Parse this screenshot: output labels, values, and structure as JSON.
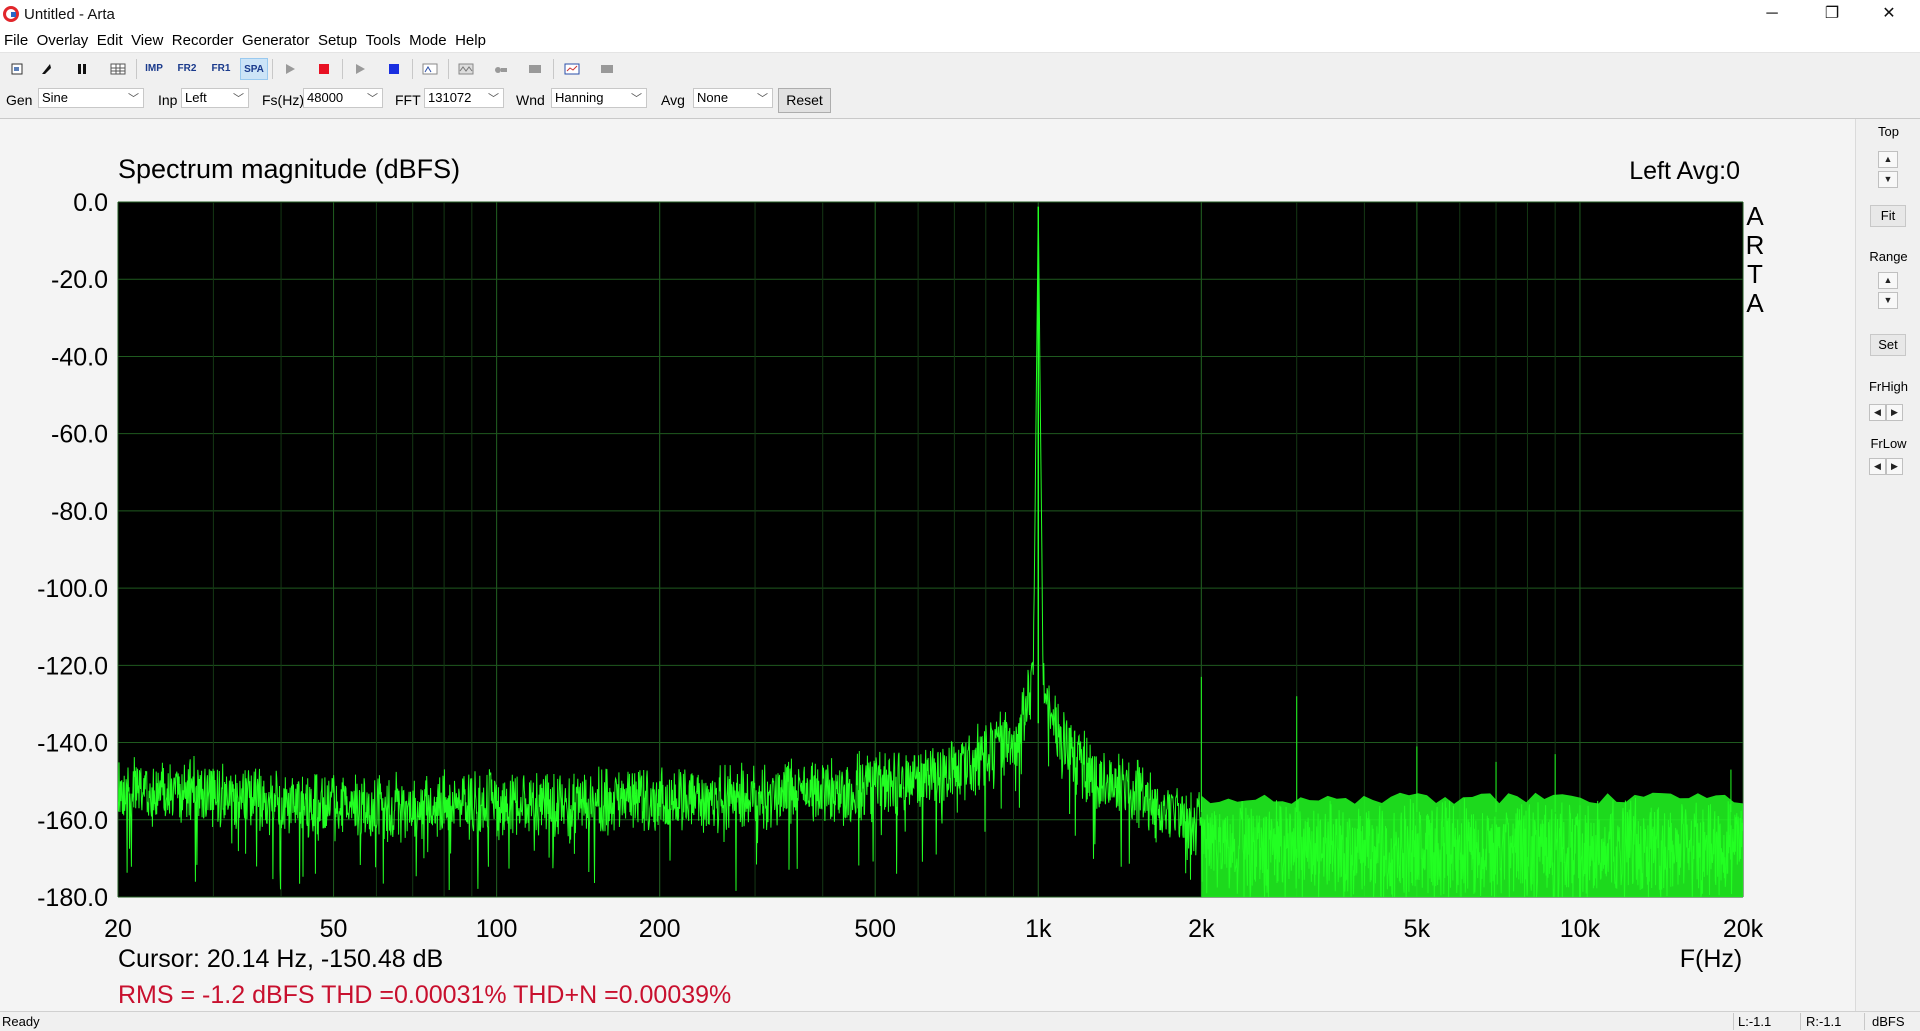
{
  "window": {
    "title": "Untitled - Arta",
    "minimize": "─",
    "restore": "❐",
    "close": "✕"
  },
  "menu": [
    "File",
    "Overlay",
    "Edit",
    "View",
    "Recorder",
    "Generator",
    "Setup",
    "Tools",
    "Mode",
    "Help"
  ],
  "toolbar": {
    "imp": "IMP",
    "fr2": "FR2",
    "fr1": "FR1",
    "spa": "SPA"
  },
  "controls": {
    "gen_label": "Gen",
    "gen_value": "Sine",
    "inp_label": "Inp",
    "inp_value": "Left",
    "fs_label": "Fs(Hz)",
    "fs_value": "48000",
    "fft_label": "FFT",
    "fft_value": "131072",
    "wnd_label": "Wnd",
    "wnd_value": "Hanning",
    "avg_label": "Avg",
    "avg_value": "None",
    "reset_label": "Reset"
  },
  "right_panel": {
    "top_label": "Top",
    "fit_label": "Fit",
    "range_label": "Range",
    "set_label": "Set",
    "frhigh_label": "FrHigh",
    "frlow_label": "FrLow"
  },
  "chart_data": {
    "type": "line",
    "title": "Spectrum magnitude (dBFS)",
    "channel_info": "Left  Avg:0",
    "watermark": "ARTA",
    "xlabel": "F(Hz)",
    "x_scale": "log",
    "xlim": [
      20,
      20000
    ],
    "ylim": [
      -180,
      0
    ],
    "y_ticks": [
      "0.0",
      "-20.0",
      "-40.0",
      "-60.0",
      "-80.0",
      "-100.0",
      "-120.0",
      "-140.0",
      "-160.0",
      "-180.0"
    ],
    "x_ticks": [
      "20",
      "50",
      "100",
      "200",
      "500",
      "1k",
      "2k",
      "5k",
      "10k",
      "20k"
    ],
    "x_tick_values": [
      20,
      50,
      100,
      200,
      500,
      1000,
      2000,
      5000,
      10000,
      20000
    ],
    "background": "#000000",
    "grid_color": "#1f5a1f",
    "trace_color": "#22ff22",
    "cursor_text": "Cursor: 20.14 Hz, -150.48 dB",
    "measure_text": "RMS =   -1.2 dBFS THD =0.00031% THD+N =0.00039%",
    "measure_color": "#c8102e",
    "series": [
      {
        "x": [
          20,
          30,
          40,
          60,
          100,
          200,
          400,
          600,
          800,
          900,
          950,
          980,
          1000,
          1020,
          1050,
          1100,
          1200,
          1500,
          1800,
          2000,
          2500,
          5000,
          10000,
          20000
        ],
        "y": [
          -148,
          -149,
          -152,
          -153,
          -152,
          -151,
          -149,
          -146,
          -140,
          -135,
          -127,
          -118,
          -1.2,
          -118,
          -128,
          -136,
          -142,
          -149,
          -155,
          -158,
          -160,
          -160,
          -160,
          -160
        ]
      }
    ],
    "harmonics": [
      {
        "x": 2000,
        "y": -123
      },
      {
        "x": 3000,
        "y": -128
      },
      {
        "x": 5000,
        "y": -141
      },
      {
        "x": 7000,
        "y": -145
      },
      {
        "x": 9000,
        "y": -143
      },
      {
        "x": 19000,
        "y": -147
      }
    ]
  },
  "status": {
    "ready": "Ready",
    "left_level": "L:-1.1",
    "right_level": "R:-1.1",
    "unit": "dBFS"
  }
}
